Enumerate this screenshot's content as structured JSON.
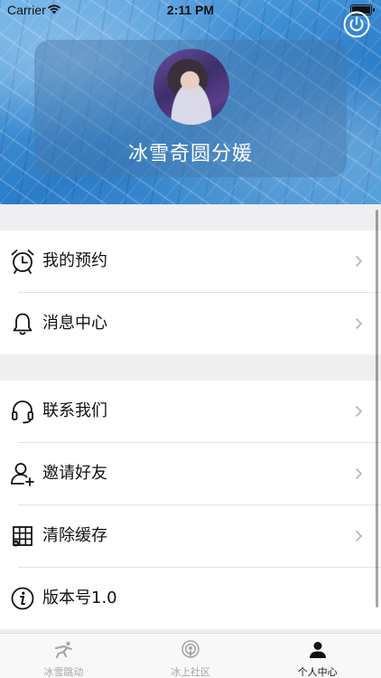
{
  "status_bar": {
    "carrier": "Carrier",
    "time": "2:11 PM"
  },
  "profile": {
    "username": "冰雪奇圆分媛",
    "avatar_icon": "user-photo"
  },
  "menu": {
    "group1": [
      {
        "label": "我的预约",
        "icon": "alarm-clock-icon"
      },
      {
        "label": "消息中心",
        "icon": "bell-icon"
      }
    ],
    "group2": [
      {
        "label": "联系我们",
        "icon": "headset-icon"
      },
      {
        "label": "邀请好友",
        "icon": "add-user-icon"
      },
      {
        "label": "清除缓存",
        "icon": "cache-grid-icon"
      },
      {
        "label": "版本号1.0",
        "icon": "info-icon"
      }
    ]
  },
  "tabs": [
    {
      "label": "冰雪跳动",
      "icon": "skater-icon",
      "active": false
    },
    {
      "label": "冰上社区",
      "icon": "podcast-icon",
      "active": false
    },
    {
      "label": "个人中心",
      "icon": "person-icon",
      "active": true
    }
  ],
  "colors": {
    "header_blue": "#3f8fd4",
    "tab_active": "#111111",
    "tab_inactive": "#a6a6a6"
  }
}
